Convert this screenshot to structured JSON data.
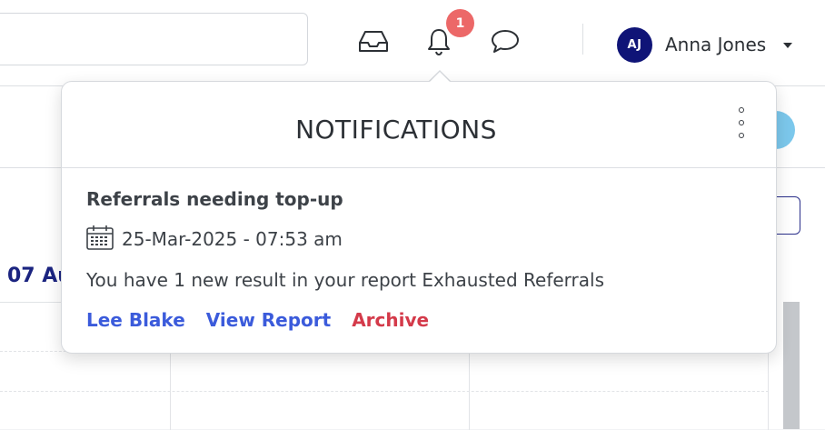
{
  "header": {
    "search": {
      "placeholder": ""
    },
    "notification_count": "1",
    "user": {
      "initials": "AJ",
      "name": "Anna Jones"
    },
    "icons": [
      "inbox-tray-icon",
      "bell-icon",
      "chat-bubble-icon",
      "caret-down-icon"
    ]
  },
  "background": {
    "date_heading": "07 Au"
  },
  "notifications": {
    "title": "NOTIFICATIONS",
    "item": {
      "title": "Referrals needing top-up",
      "datetime": "25-Mar-2025 - 07:53 am",
      "message": "You have 1 new result in your report Exhausted Referrals",
      "actions": {
        "person": "Lee Blake",
        "view": "View Report",
        "archive": "Archive"
      }
    }
  },
  "colors": {
    "badge": "#ec6868",
    "avatar": "#0f1477",
    "link": "#3b5bdb",
    "archive": "#d43a4a"
  }
}
